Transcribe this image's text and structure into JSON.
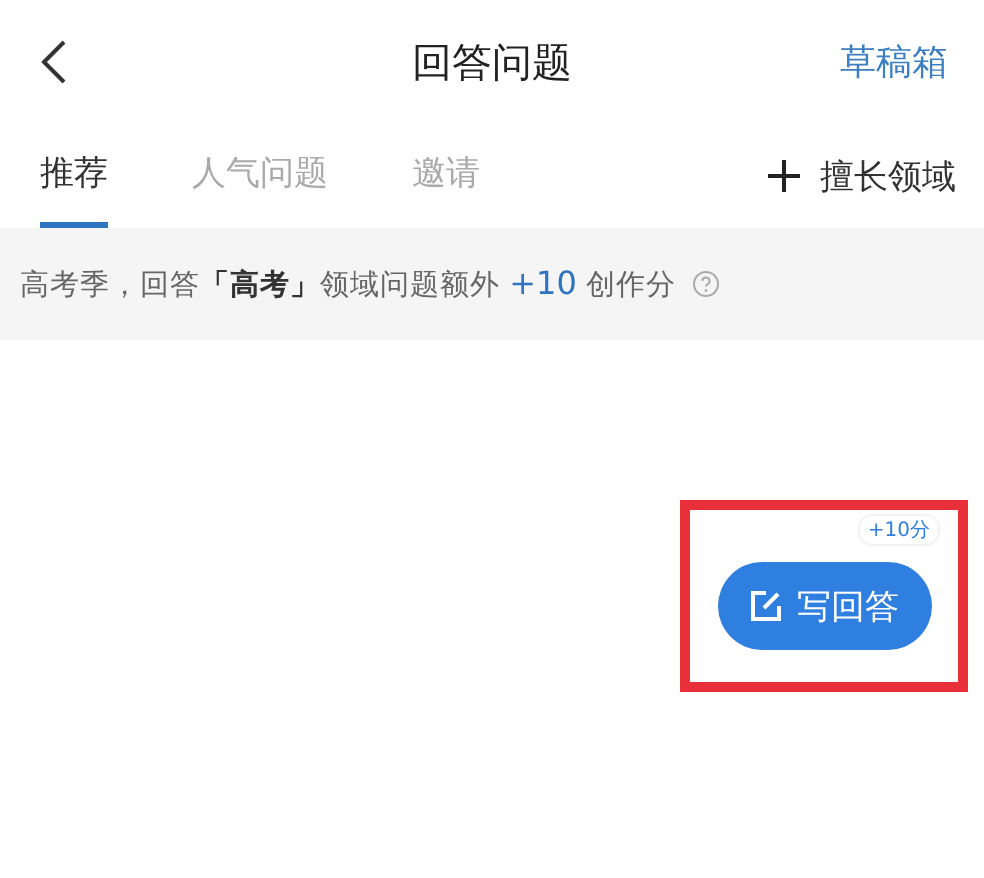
{
  "header": {
    "title": "回答问题",
    "action": "草稿箱"
  },
  "tabs": [
    {
      "label": "推荐",
      "selected": true
    },
    {
      "label": "人气问题",
      "selected": false
    },
    {
      "label": "邀请",
      "selected": false
    }
  ],
  "add_domain": {
    "label": "擅长领域"
  },
  "banner": {
    "prefix": "高考季，回答**「高考」**领域问题额外",
    "highlight": "+10",
    "suffix": "创作分"
  },
  "write_button": {
    "label": "写回答",
    "badge": "+10分",
    "highlighted": true
  }
}
